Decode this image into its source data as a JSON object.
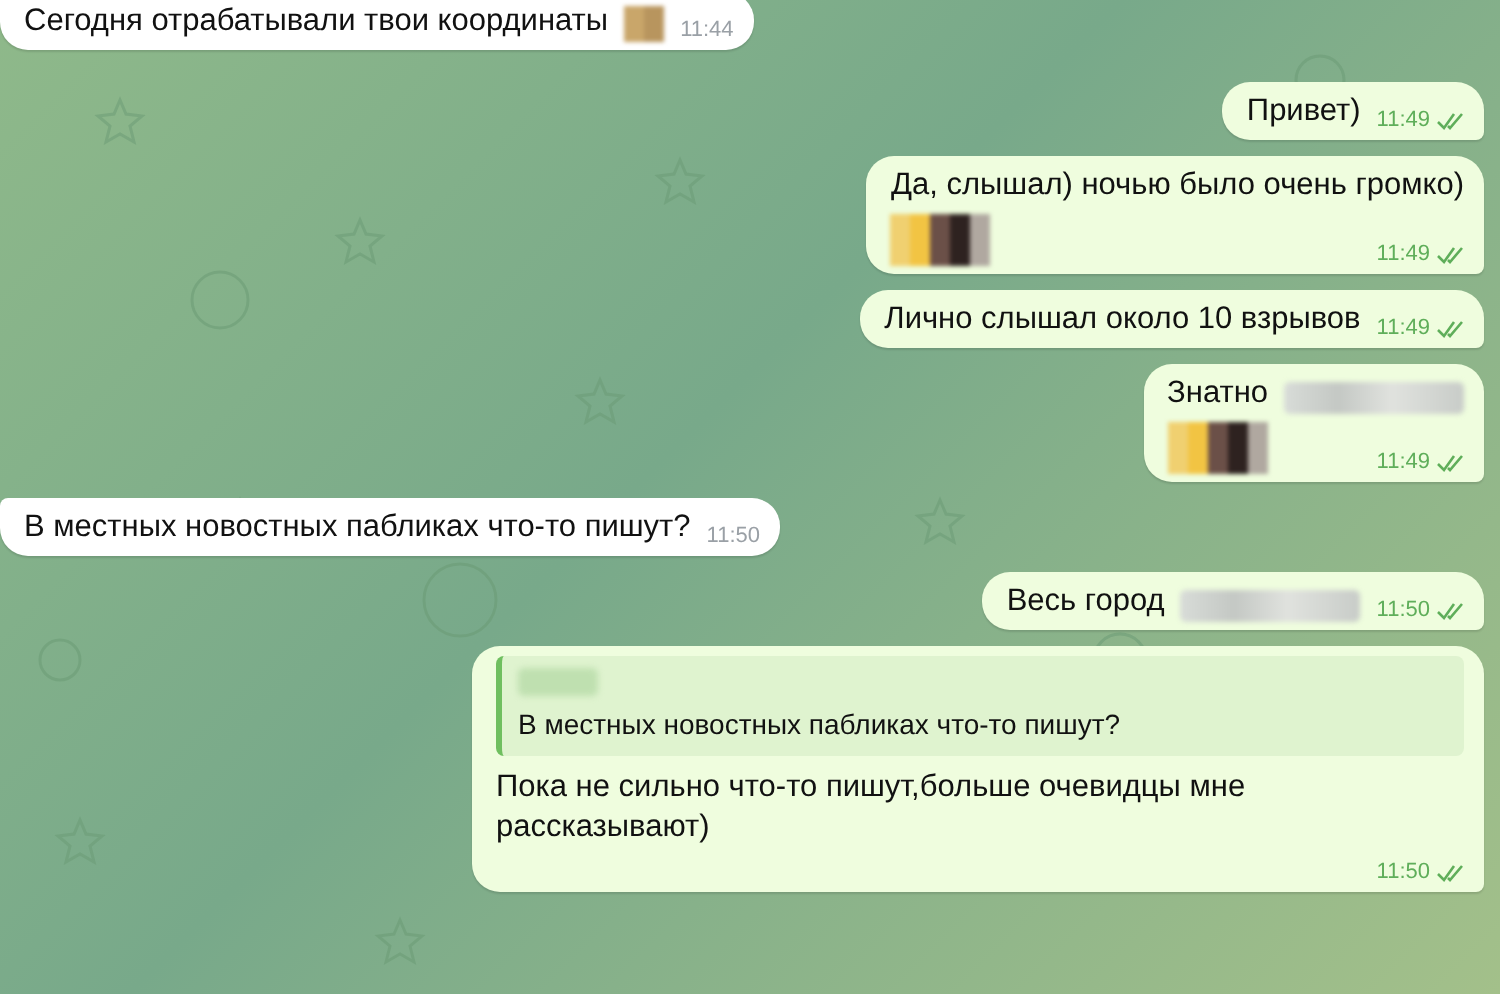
{
  "messages": [
    {
      "outgoing": false,
      "text": "Сегодня отрабатывали твои координаты",
      "blurred_emoji": true,
      "time": "11:44"
    },
    {
      "outgoing": true,
      "text": "Привет)",
      "time": "11:49",
      "read": true
    },
    {
      "outgoing": true,
      "text": "Да, слышал) ночью было очень громко)",
      "blurred_emoji_line": true,
      "time": "11:49",
      "read": true
    },
    {
      "outgoing": true,
      "text": "Лично слышал около 10 взрывов",
      "time": "11:49",
      "read": true
    },
    {
      "outgoing": true,
      "text": "Знатно",
      "blurred_text": true,
      "blurred_emoji_line": true,
      "time": "11:49",
      "read": true
    },
    {
      "outgoing": false,
      "text": "В местных новостных пабликах что-то пишут?",
      "time": "11:50"
    },
    {
      "outgoing": true,
      "text": "Весь город",
      "blurred_text": true,
      "time": "11:50",
      "read": true
    },
    {
      "outgoing": true,
      "reply": {
        "blurred_name": true,
        "text": "В местных новостных пабликах что-то пишут?"
      },
      "text": "Пока не сильно что-то пишут,больше очевидцы мне рассказывают)",
      "time": "11:50",
      "read": true
    }
  ]
}
